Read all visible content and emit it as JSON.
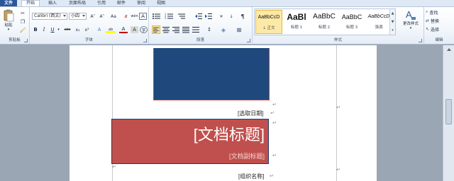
{
  "tabs": [
    {
      "label": "文件"
    },
    {
      "label": "开始"
    },
    {
      "label": "插入"
    },
    {
      "label": "页面布局"
    },
    {
      "label": "引用"
    },
    {
      "label": "邮件"
    },
    {
      "label": "审阅"
    },
    {
      "label": "视图"
    }
  ],
  "clipboard": {
    "paste_label": "粘贴",
    "group_label": "剪贴板"
  },
  "font": {
    "name": "Calibri (西文)",
    "size": "小四",
    "group_label": "字体",
    "buttons": {
      "grow": "A˄",
      "shrink": "A˅",
      "case": "Aa",
      "clear": "ⱥ",
      "phonetic": "wén",
      "border_char": "A",
      "bold": "B",
      "italic": "I",
      "underline": "U",
      "strike": "abc",
      "subscript": "x₂",
      "superscript": "x²",
      "effects": "A",
      "highlight": "ab",
      "color": "A",
      "aa_shade": "A",
      "enclose": "字"
    },
    "font_color_hex": "#c00000",
    "highlight_hex": "#ffff00"
  },
  "paragraph": {
    "group_label": "段落"
  },
  "styles": {
    "group_label": "样式",
    "items": [
      {
        "sample": "AaBbCcD",
        "name": "↓ 正文"
      },
      {
        "sample": "AaBl",
        "name": "标题 1"
      },
      {
        "sample": "AaBbC",
        "name": "标题 2"
      },
      {
        "sample": "AaBbC",
        "name": "标题 3"
      },
      {
        "sample": "AaBbCcD",
        "name": "强调"
      }
    ],
    "change_styles_label": "更改样式"
  },
  "editing": {
    "group_label": "编辑",
    "find": "查找",
    "replace": "替换",
    "select": "选择"
  },
  "document": {
    "date_placeholder": "[选取日期]",
    "title_placeholder": "[文档标题]",
    "subtitle_placeholder": "[文档副标题]",
    "company_placeholder": "[组织名称]",
    "blue_hex": "#1f497d",
    "red_hex": "#c0504d"
  }
}
